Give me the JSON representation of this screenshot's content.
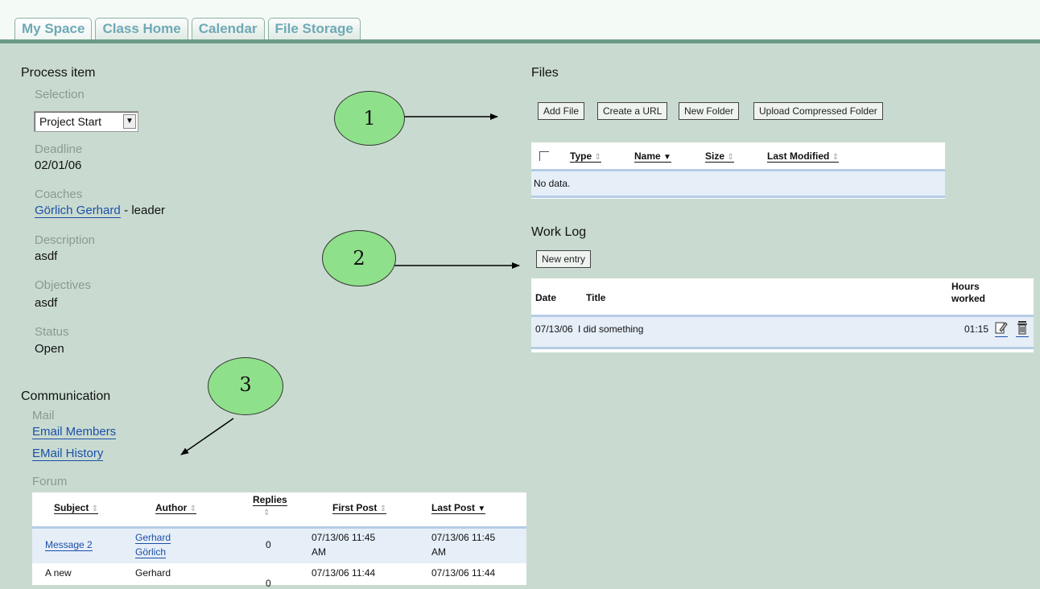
{
  "tabs": [
    "My Space",
    "Class Home",
    "Calendar",
    "File Storage"
  ],
  "process": {
    "title": "Process item",
    "selection_label": "Selection",
    "selection_value": "Project Start",
    "deadline_label": "Deadline",
    "deadline_value": "02/01/06",
    "coaches_label": "Coaches",
    "coach_name": "Görlich Gerhard",
    "coach_role": "- leader",
    "description_label": "Description",
    "description_value": "asdf",
    "objectives_label": "Objectives",
    "objectives_value": "asdf",
    "status_label": "Status",
    "status_value": "Open"
  },
  "communication": {
    "title": "Communication",
    "mail_label": "Mail",
    "email_members": "Email Members",
    "email_history": "EMail History",
    "forum_label": "Forum"
  },
  "forum": {
    "headers": {
      "subject": "Subject",
      "author": "Author",
      "replies": "Replies",
      "first_post": "First Post",
      "last_post": "Last Post"
    },
    "rows": [
      {
        "subject": "Message 2",
        "author_first": "Gerhard",
        "author_last": "Görlich",
        "replies": "0",
        "first_post_a": "07/13/06 11:45",
        "first_post_b": "AM",
        "last_post_a": "07/13/06 11:45",
        "last_post_b": "AM"
      },
      {
        "subject": "A new",
        "author_first": "Gerhard",
        "replies": "0",
        "first_post_a": "07/13/06 11:44",
        "last_post_a": "07/13/06 11:44"
      }
    ]
  },
  "files": {
    "title": "Files",
    "buttons": {
      "add_file": "Add File",
      "create_url": "Create a URL",
      "new_folder": "New Folder",
      "upload_compressed": "Upload Compressed Folder"
    },
    "headers": {
      "type": "Type",
      "name": "Name",
      "size": "Size",
      "last_modified": "Last Modified"
    },
    "empty": "No data."
  },
  "worklog": {
    "title": "Work Log",
    "new_entry": "New entry",
    "headers": {
      "date": "Date",
      "title": "Title",
      "hours_1": "Hours",
      "hours_2": "worked"
    },
    "rows": [
      {
        "date": "07/13/06",
        "title": "I did something",
        "hours": "01:15"
      }
    ]
  },
  "callouts": [
    "1",
    "2",
    "3"
  ]
}
